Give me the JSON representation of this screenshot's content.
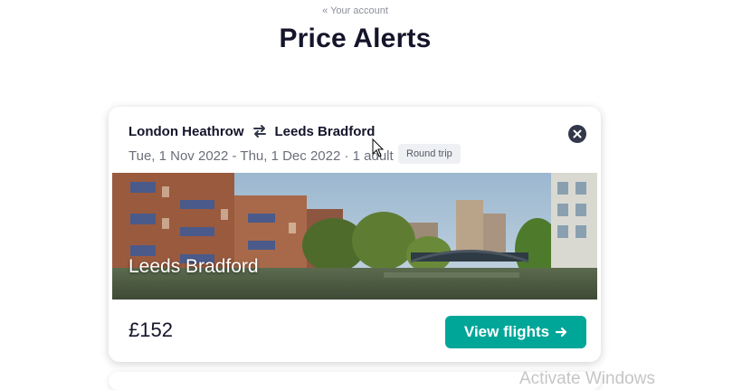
{
  "header": {
    "back_link": "« Your account",
    "title": "Price Alerts"
  },
  "alert": {
    "origin": "London Heathrow",
    "destination": "Leeds Bradford",
    "details": "Tue, 1 Nov 2022 - Thu, 1 Dec 2022 · 1 adult",
    "trip_type": "Round trip",
    "image_caption": "Leeds Bradford",
    "price": "£152",
    "cta_label": "View flights",
    "icons": [
      "swap-arrows-icon",
      "close-icon",
      "arrow-right-icon"
    ],
    "colors": {
      "cta": "#00a698",
      "close": "#33374a"
    }
  },
  "system": {
    "watermark": "Activate Windows"
  }
}
